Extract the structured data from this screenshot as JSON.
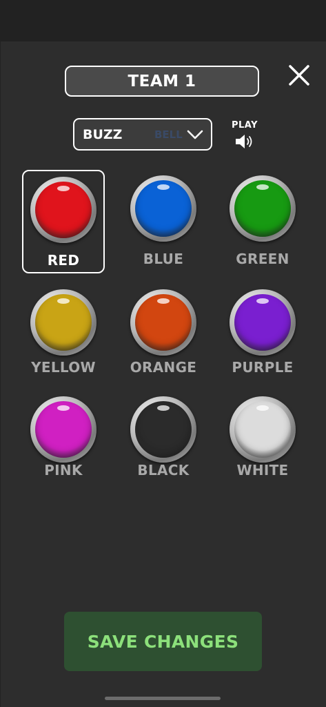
{
  "header": {
    "team_title": "TEAM 1",
    "close_icon": "close-icon"
  },
  "sound": {
    "selected": "BUZZ",
    "ghost_text": "BELL",
    "play_label": "PLAY",
    "play_icon": "speaker-icon"
  },
  "colors": [
    {
      "label": "RED",
      "hex": "#e0141c",
      "selected": true
    },
    {
      "label": "BLUE",
      "hex": "#0a62d6",
      "selected": false
    },
    {
      "label": "GREEN",
      "hex": "#179a12",
      "selected": false
    },
    {
      "label": "YELLOW",
      "hex": "#c9a415",
      "selected": false
    },
    {
      "label": "ORANGE",
      "hex": "#d24610",
      "selected": false
    },
    {
      "label": "PURPLE",
      "hex": "#7a1fd0",
      "selected": false
    },
    {
      "label": "PINK",
      "hex": "#d020c2",
      "selected": false
    },
    {
      "label": "BLACK",
      "hex": "#2b2b2b",
      "selected": false
    },
    {
      "label": "WHITE",
      "hex": "#dcdcdc",
      "selected": false
    }
  ],
  "label_colors": {
    "selected": "#ffffff",
    "unselected": "#a9a9a9"
  },
  "footer": {
    "save_label": "SAVE CHANGES"
  }
}
